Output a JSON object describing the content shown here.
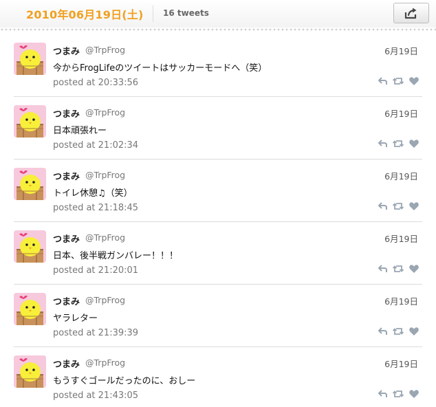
{
  "header": {
    "date_title": "2010年06月19日(土)",
    "tweet_count": "16 tweets",
    "share_icon": "share-icon"
  },
  "colors": {
    "accent": "#f0a020",
    "avatar_bg": "#f7c9dd",
    "chick": "#f7ef3a",
    "action_icons": "#9aa6b2"
  },
  "tweets": [
    {
      "name": "つまみ",
      "handle": "@TrpFrog",
      "date": "6月19日",
      "text": "今からFrogLifeのツイートはサッカーモードへ（笑）",
      "posted": "posted at 20:33:56"
    },
    {
      "name": "つまみ",
      "handle": "@TrpFrog",
      "date": "6月19日",
      "text": "日本頑張れー",
      "posted": "posted at 21:02:34"
    },
    {
      "name": "つまみ",
      "handle": "@TrpFrog",
      "date": "6月19日",
      "text": "トイレ休憩♫（笑）",
      "posted": "posted at 21:18:45"
    },
    {
      "name": "つまみ",
      "handle": "@TrpFrog",
      "date": "6月19日",
      "text": "日本、後半戦ガンバレー！！！",
      "posted": "posted at 21:20:01"
    },
    {
      "name": "つまみ",
      "handle": "@TrpFrog",
      "date": "6月19日",
      "text": "ヤラレター",
      "posted": "posted at 21:39:39"
    },
    {
      "name": "つまみ",
      "handle": "@TrpFrog",
      "date": "6月19日",
      "text": "もうすぐゴールだったのに、おしー",
      "posted": "posted at 21:43:05"
    }
  ]
}
